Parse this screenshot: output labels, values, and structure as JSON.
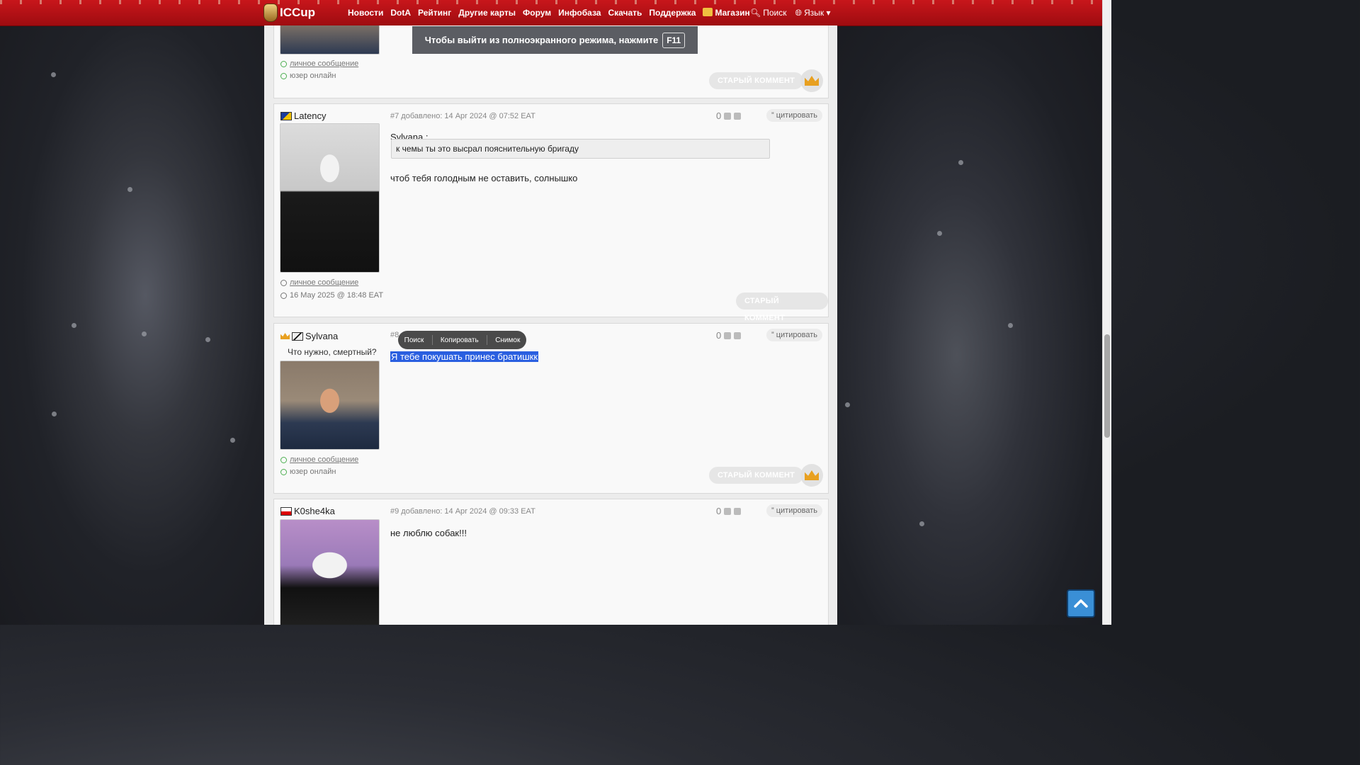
{
  "header": {
    "logo_text": "ICCup",
    "nav": [
      "Новости",
      "DotA",
      "Рейтинг",
      "Другие карты",
      "Форум",
      "Инфобаза",
      "Скачать",
      "Поддержка",
      "Магазин"
    ],
    "search_label": "Поиск",
    "language_label": "Язык"
  },
  "fullscreen_notice": {
    "text": "Чтобы выйти из полноэкранного режима, нажмите",
    "key": "F11"
  },
  "context_toolbar": {
    "search": "Поиск",
    "copy": "Копировать",
    "screenshot": "Снимок"
  },
  "posts": [
    {
      "pm_label": "личное сообщение",
      "status": "юзер онлайн",
      "old_comment": "СТАРЫЙ КОММЕНТ"
    },
    {
      "username": "Latency",
      "header": "#7 добавлено: 14 Apr 2024 @ 07:52 EAT",
      "votes": "0",
      "quote_btn": "цитировать",
      "quote_author": "Sylvana :",
      "quote_text": "к чемы ты это высрал пояснительную бригаду",
      "text": "чтоб тебя голодным не оставить, солнышко",
      "pm_label": "личное сообщение",
      "last_seen": "16 May 2025 @ 18:48 EAT",
      "old_comment": "СТАРЫЙ КОММЕНТ"
    },
    {
      "username": "Sylvana",
      "signature": "Что нужно, смертный?",
      "header": "#8",
      "votes": "0",
      "quote_btn": "цитировать",
      "text": "Я тебе покушать принес братишкк",
      "pm_label": "личное сообщение",
      "status": "юзер онлайн",
      "old_comment": "СТАРЫЙ КОММЕНТ"
    },
    {
      "username": "K0she4ka",
      "header": "#9 добавлено: 14 Apr 2024 @ 09:33 EAT",
      "votes": "0",
      "quote_btn": "цитировать",
      "text": "не люблю собак!!!"
    }
  ],
  "colors": {
    "header_red": "#b31217",
    "selection_blue": "#2a5fe0",
    "online_green": "#4caf50",
    "crown_gold": "#e8a020"
  },
  "icons": [
    "shop-icon",
    "search-icon",
    "globe-icon",
    "caret-down-icon",
    "crown-icon",
    "thumb-up-icon",
    "thumb-down-icon",
    "quote-icon",
    "pm-icon",
    "online-icon",
    "clock-icon",
    "scroll-top-icon"
  ]
}
